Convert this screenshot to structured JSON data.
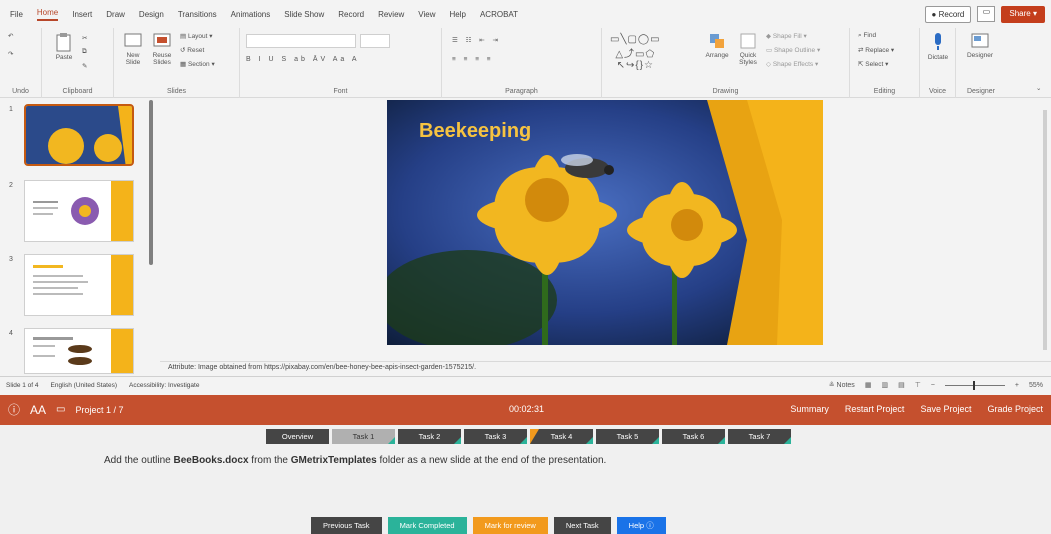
{
  "menu": {
    "tabs": [
      "File",
      "Home",
      "Insert",
      "Draw",
      "Design",
      "Transitions",
      "Animations",
      "Slide Show",
      "Record",
      "Review",
      "View",
      "Help",
      "ACROBAT"
    ],
    "active_index": 1,
    "record_label": "Record",
    "share_label": "Share"
  },
  "ribbon": {
    "groups": {
      "undo": "Undo",
      "clipboard": "Clipboard",
      "slides": "Slides",
      "font": "Font",
      "paragraph": "Paragraph",
      "drawing": "Drawing",
      "editing": "Editing",
      "voice": "Voice",
      "designer": "Designer"
    },
    "paste": "Paste",
    "new_slide": "New Slide",
    "reuse_slides": "Reuse Slides",
    "layout": "Layout",
    "reset": "Reset",
    "section": "Section",
    "arrange": "Arrange",
    "quick_styles": "Quick Styles",
    "shape_fill": "Shape Fill",
    "shape_outline": "Shape Outline",
    "shape_effects": "Shape Effects",
    "find": "Find",
    "replace": "Replace",
    "select": "Select",
    "dictate": "Dictate",
    "designer_btn": "Designer"
  },
  "thumbnails": [
    {
      "num": "1"
    },
    {
      "num": "2"
    },
    {
      "num": "3"
    },
    {
      "num": "4"
    }
  ],
  "slide": {
    "title": "Beekeeping"
  },
  "notes": {
    "text": "Attribute: Image obtained from https://pixabay.com/en/bee-honey-bee-apis-insect-garden-1575215/."
  },
  "status": {
    "slide_count": "Slide 1 of 4",
    "language": "English (United States)",
    "accessibility": "Accessibility: Investigate",
    "notes": "Notes",
    "zoom": "55%"
  },
  "gmetrix": {
    "font_icon": "AA",
    "project": "Project 1 / 7",
    "timer": "00:02:31",
    "links": [
      "Summary",
      "Restart Project",
      "Save Project",
      "Grade Project"
    ],
    "tasks": [
      "Overview",
      "Task 1",
      "Task 2",
      "Task 3",
      "Task 4",
      "Task 5",
      "Task 6",
      "Task 7"
    ],
    "instruction_pre": "Add the outline ",
    "instruction_file": "BeeBooks.docx",
    "instruction_mid": " from the ",
    "instruction_folder": "GMetrixTemplates",
    "instruction_post": " folder as a new slide at the end of the presentation.",
    "buttons": {
      "prev": "Previous Task",
      "complete": "Mark Completed",
      "review": "Mark for review",
      "next": "Next Task",
      "help": "Help"
    }
  },
  "colors": {
    "accent": "#c5502e",
    "task_done": "#2bb39a",
    "review": "#f29a1d",
    "help": "#1a73e8"
  }
}
